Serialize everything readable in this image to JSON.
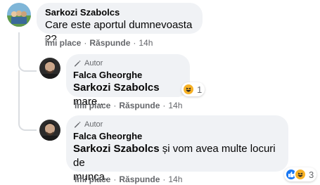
{
  "comments": [
    {
      "author": "Sarkozi Szabolcs",
      "text": "Care este aportul dumnevoasta ??",
      "like_label": "Îmi place",
      "reply_label": "Răspunde",
      "time": "14h"
    },
    {
      "author_badge": "Autor",
      "author": "Falca Gheorghe",
      "mention": "Sarkozi Szabolcs",
      "text": " mare...",
      "like_label": "Îmi place",
      "reply_label": "Răspunde",
      "time": "14h",
      "reaction_count": "1"
    },
    {
      "author_badge": "Autor",
      "author": "Falca Gheorghe",
      "mention": "Sarkozi Szabolcs",
      "text_line1": " și vom avea multe locuri de",
      "text_line2": "munca.",
      "like_label": "Îmi place",
      "reply_label": "Răspunde",
      "time": "14h",
      "reaction_count": "3"
    }
  ],
  "colors": {
    "bubble": "#f0f2f5",
    "meta": "#65676b",
    "like_blue": "#1877f2",
    "haha_yellow": "#f7b125"
  },
  "icons": [
    "pencil-icon",
    "haha-reaction-icon",
    "like-reaction-icon"
  ]
}
